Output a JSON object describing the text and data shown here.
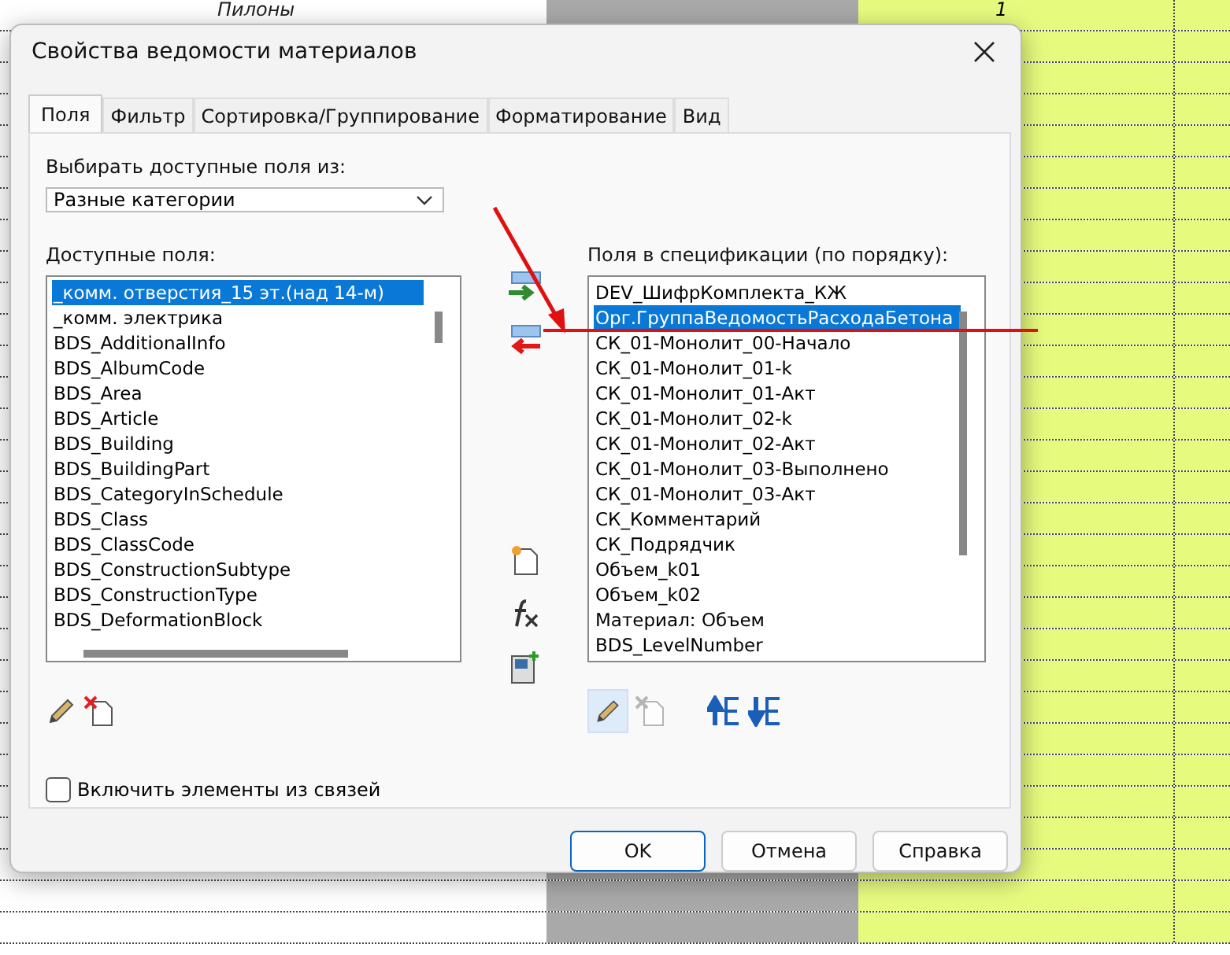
{
  "background_sheet": {
    "row_label": "Пилоны",
    "value": "1"
  },
  "window": {
    "title": "Свойства ведомости материалов"
  },
  "tabs": [
    {
      "label": "Поля",
      "selected": true
    },
    {
      "label": "Фильтр",
      "selected": false
    },
    {
      "label": "Сортировка/Группирование",
      "selected": false
    },
    {
      "label": "Форматирование",
      "selected": false
    },
    {
      "label": "Вид",
      "selected": false
    }
  ],
  "source": {
    "label": "Выбирать доступные поля из:",
    "value": "Разные категории"
  },
  "available_fields": {
    "label": "Доступные поля:",
    "items": [
      {
        "text": "_комм. отверстия_15 эт.(над 14-м)",
        "selected": true
      },
      {
        "text": "_комм. электрика",
        "selected": false
      },
      {
        "text": "BDS_AdditionalInfo",
        "selected": false
      },
      {
        "text": "BDS_AlbumCode",
        "selected": false
      },
      {
        "text": "BDS_Area",
        "selected": false
      },
      {
        "text": "BDS_Article",
        "selected": false
      },
      {
        "text": "BDS_Building",
        "selected": false
      },
      {
        "text": "BDS_BuildingPart",
        "selected": false
      },
      {
        "text": "BDS_CategoryInSchedule",
        "selected": false
      },
      {
        "text": "BDS_Class",
        "selected": false
      },
      {
        "text": "BDS_ClassCode",
        "selected": false
      },
      {
        "text": "BDS_ConstructionSubtype",
        "selected": false
      },
      {
        "text": "BDS_ConstructionType",
        "selected": false
      },
      {
        "text": "BDS_DeformationBlock",
        "selected": false
      }
    ]
  },
  "schedule_fields": {
    "label": "Поля в спецификации (по порядку):",
    "items": [
      {
        "text": "DEV_ШифрКомплекта_КЖ",
        "selected": false
      },
      {
        "text": "Орг.ГруппаВедомостьРасходаБетона",
        "selected": true
      },
      {
        "text": "СК_01-Монолит_00-Начало",
        "selected": false
      },
      {
        "text": "СК_01-Монолит_01-k",
        "selected": false
      },
      {
        "text": "СК_01-Монолит_01-Акт",
        "selected": false
      },
      {
        "text": "СК_01-Монолит_02-k",
        "selected": false
      },
      {
        "text": "СК_01-Монолит_02-Акт",
        "selected": false
      },
      {
        "text": "СК_01-Монолит_03-Выполнено",
        "selected": false
      },
      {
        "text": "СК_01-Монолит_03-Акт",
        "selected": false
      },
      {
        "text": "СК_Комментарий",
        "selected": false
      },
      {
        "text": "СК_Подрядчик",
        "selected": false
      },
      {
        "text": "Объем_k01",
        "selected": false
      },
      {
        "text": "Объем_k02",
        "selected": false
      },
      {
        "text": "Материал: Объем",
        "selected": false
      },
      {
        "text": "BDS_LevelNumber",
        "selected": false
      }
    ]
  },
  "include_links": {
    "label": "Включить элементы из связей",
    "checked": false
  },
  "buttons": [
    {
      "label": "OK",
      "kind": "primary"
    },
    {
      "label": "Отмена",
      "kind": "default"
    },
    {
      "label": "Справка",
      "kind": "default"
    }
  ]
}
